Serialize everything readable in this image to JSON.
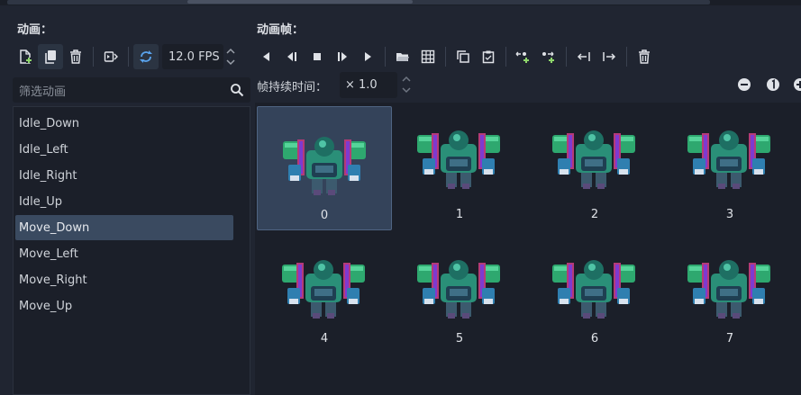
{
  "left": {
    "title": "动画：",
    "search_placeholder": "筛选动画",
    "fps_value": "12.0 FPS",
    "animations": [
      "Idle_Down",
      "Idle_Left",
      "Idle_Right",
      "Idle_Up",
      "Move_Down",
      "Move_Left",
      "Move_Right",
      "Move_Up"
    ],
    "selected_index": 4
  },
  "right": {
    "title": "动画帧：",
    "duration_label": "帧持续时间：",
    "duration_value": "× 1.0",
    "frames": [
      "0",
      "1",
      "2",
      "3",
      "4",
      "5",
      "6",
      "7"
    ],
    "selected_frame": 0
  },
  "colors": {
    "selection": "#3a4a60",
    "frame_selected": "#34435a",
    "panel": "#1b1f29",
    "background": "#202531",
    "accent_blue": "#5aa4ee"
  },
  "icons": {
    "new": "new-animation-icon",
    "duplicate": "duplicate-animation-icon",
    "delete": "delete-animation-icon",
    "autoplay": "autoplay-on-load-icon",
    "loop": "loop-icon",
    "play_backwards": "play-backwards-icon",
    "play_backwards_start": "play-backwards-from-end-icon",
    "stop": "stop-icon",
    "play_start": "play-from-start-icon",
    "play": "play-icon",
    "load_sheet": "folder-open-icon",
    "grid": "sprite-sheet-grid-icon",
    "copy": "copy-frame-icon",
    "paste": "paste-frame-icon",
    "insert_before": "insert-frame-before-icon",
    "insert_after": "insert-frame-after-icon",
    "move_left": "move-frame-left-icon",
    "move_right": "move-frame-right-icon",
    "delete_frame": "delete-frame-icon",
    "zoom_out": "zoom-out-icon",
    "zoom_reset": "zoom-reset-icon",
    "zoom_in": "zoom-in-icon",
    "search": "search-icon"
  }
}
